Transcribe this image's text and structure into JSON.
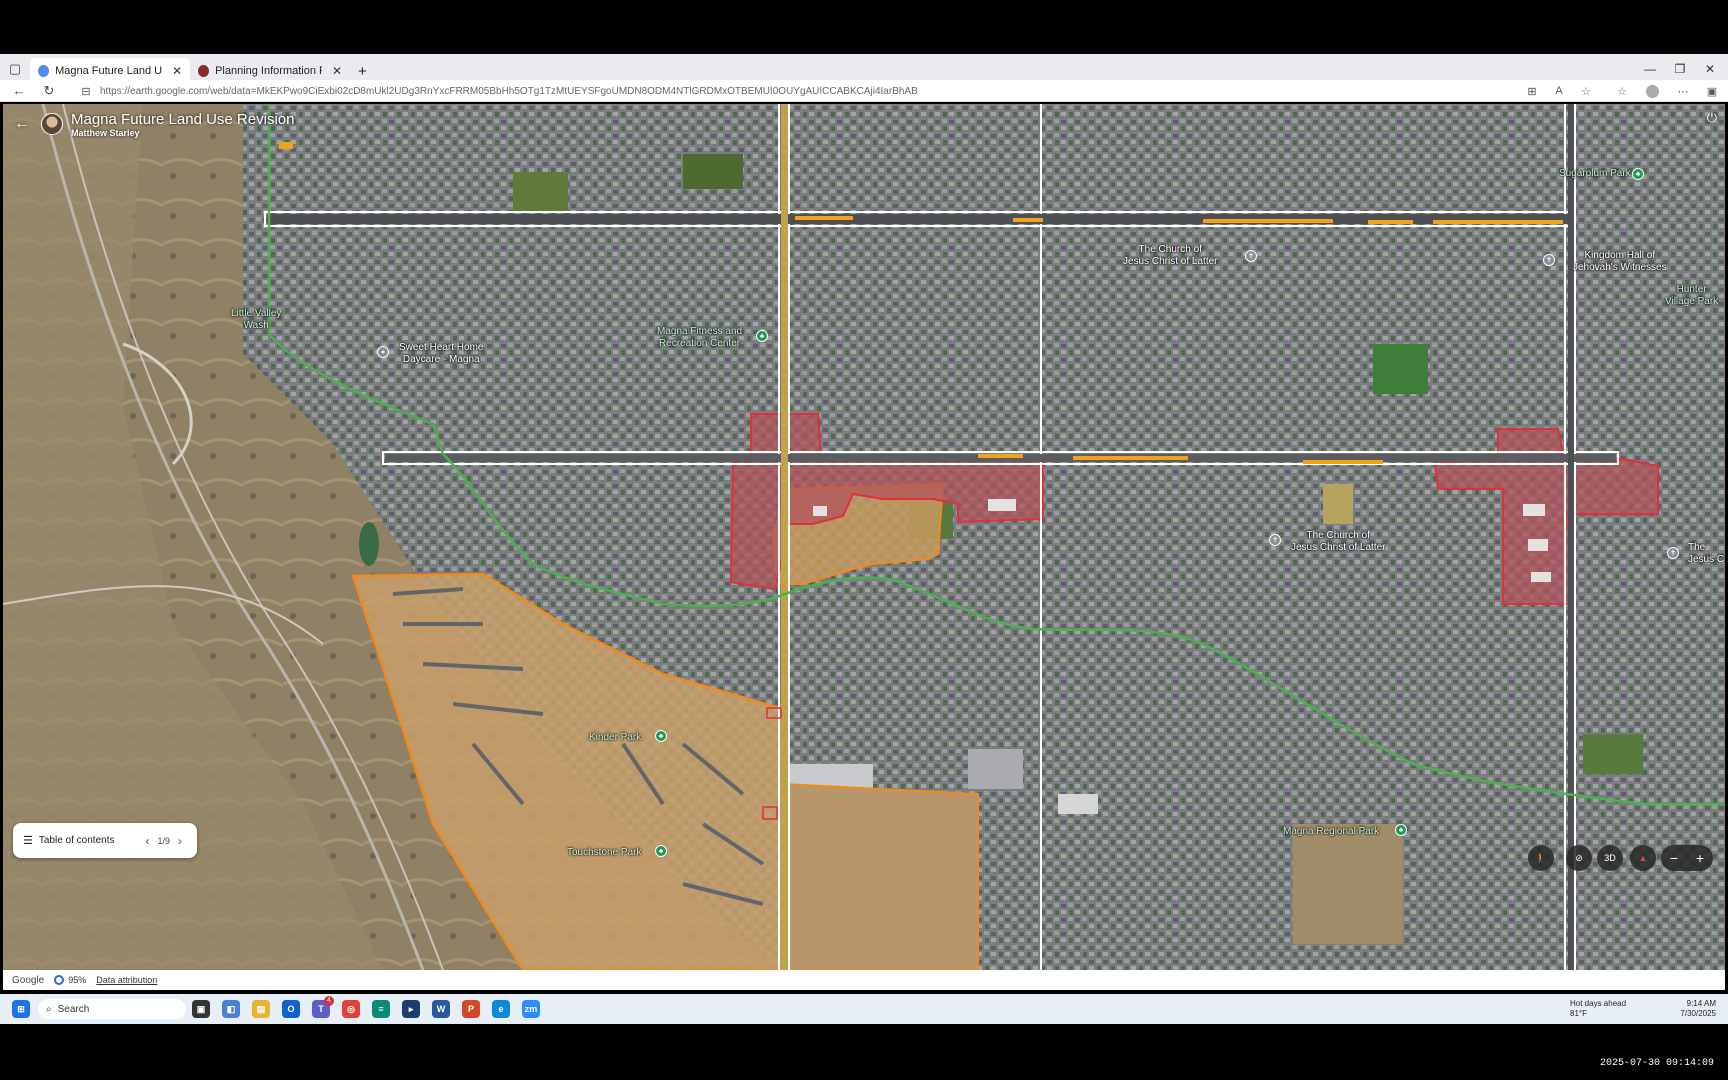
{
  "browser": {
    "tabs": [
      {
        "label": "Magna Future Land Use Revision",
        "active": true
      },
      {
        "label": "Planning Information Finder",
        "active": false
      }
    ],
    "new_tab": "+",
    "url": "https://earth.google.com/web/data=MkEKPwo9CiExbi02cD8mUkl2UDg3RnYxcFRRM05BbHh5OTg1TzMtUEYSFgoUMDN8ODM4NTlGRDMxOTBEMUI0OUYgAUICCABKCAji4IarBhAB"
  },
  "project": {
    "title": "Magna Future Land Use Revision",
    "author": "Matthew Starley"
  },
  "map_labels": {
    "sugarplum_park": "Sugarplum Park",
    "church_top": "The Church of\nJesus Christ of Latter",
    "kingdom_hall": "Kingdom Hall of\nJehovah's Witnesses",
    "hunter_village_park": "Hunter\nVillage Park",
    "little_valley_wash": "Little Valley\nWash",
    "sweet_heart": "Sweet Heart Home\nDaycare - Magna",
    "magna_fitness": "Magna Fitness and\nRecreation Center",
    "church_mid": "The Church of\nJesus Christ of Latter",
    "church_right": "The\nJesus C",
    "kinder_park": "Kinder Park",
    "touchstone_park": "Touchstone Park",
    "magna_regional_park": "Magna Regional Park"
  },
  "toc": {
    "label": "Table of contents",
    "page": "1/9"
  },
  "controls": {
    "three_d": "3D",
    "zoom_out": "−",
    "zoom_in": "+"
  },
  "statusbar": {
    "logo": "Google",
    "loading": "95%",
    "attribution": "Data attribution"
  },
  "taskbar": {
    "search_placeholder": "Search",
    "weather_title": "Hot days ahead",
    "weather_temp": "81°F",
    "time": "9:14 AM",
    "date": "7/30/2025",
    "teams_badge": "4"
  },
  "recording_timestamp": "2025-07-30 09:14:09",
  "colors": {
    "red_zone": "#e0303a",
    "orange_zone": "#f08a1c",
    "trail": "#4caf50",
    "road_outline": "#ffffff"
  }
}
